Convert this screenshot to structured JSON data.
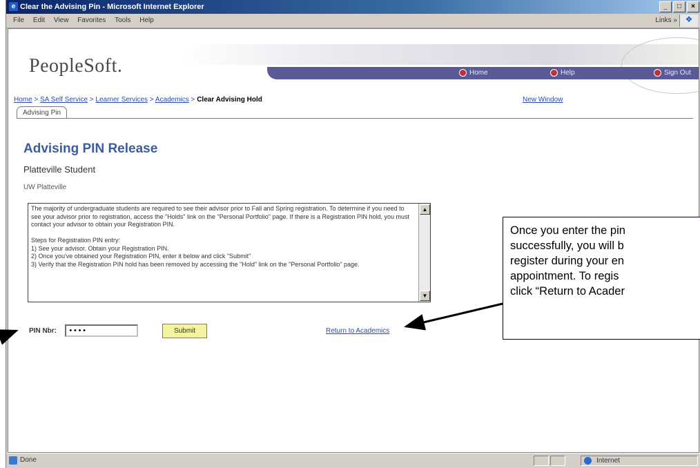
{
  "window": {
    "title": "Clear the Advising Pin - Microsoft Internet Explorer",
    "minimize": "_",
    "maximize": "□",
    "close": "×"
  },
  "menubar": {
    "items": [
      "File",
      "Edit",
      "View",
      "Favorites",
      "Tools",
      "Help"
    ],
    "links_label": "Links »"
  },
  "header": {
    "logo": "PeopleSoft.",
    "nav": [
      {
        "label": "Home"
      },
      {
        "label": "Help"
      },
      {
        "label": "Sign Out"
      }
    ]
  },
  "breadcrumb": {
    "items": [
      "Home",
      "SA Self Service",
      "Learner Services",
      "Academics"
    ],
    "separator": " > ",
    "current": "Clear Advising Hold",
    "new_window": "New Window"
  },
  "tab": {
    "label": "Advising Pin"
  },
  "page": {
    "title": "Advising PIN Release",
    "student": "Platteville Student",
    "school": "UW Platteville",
    "message": "The majority of undergraduate students are required to see their advisor prior to Fall and Spring registration. To determine if you need to see your advisor prior to registration, access the \"Holds\" link on the \"Personal Portfolio\" page. If there is a Registration PIN hold, you must contact your advisor to obtain your Registration PIN.\n\nSteps for Registration PIN entry:\n1) See your advisor. Obtain your Registration PIN.\n2) Once you've obtained your Registration PIN, enter it below and click \"Submit\"\n3) Verify that the Registration PIN hold has been removed by accessing the \"Hold\" link on the \"Personal Portfolio\" page.",
    "pin_label": "PIN Nbr:",
    "pin_value": "••••",
    "submit_label": "Submit",
    "return_link": "Return to Academics"
  },
  "status": {
    "text": "Done",
    "zone": "Internet"
  },
  "callout": {
    "text": "Once you enter the pin\nsuccessfully, you will b\nregister during your en\nappointment.  To regis\nclick “Return to Acader"
  }
}
